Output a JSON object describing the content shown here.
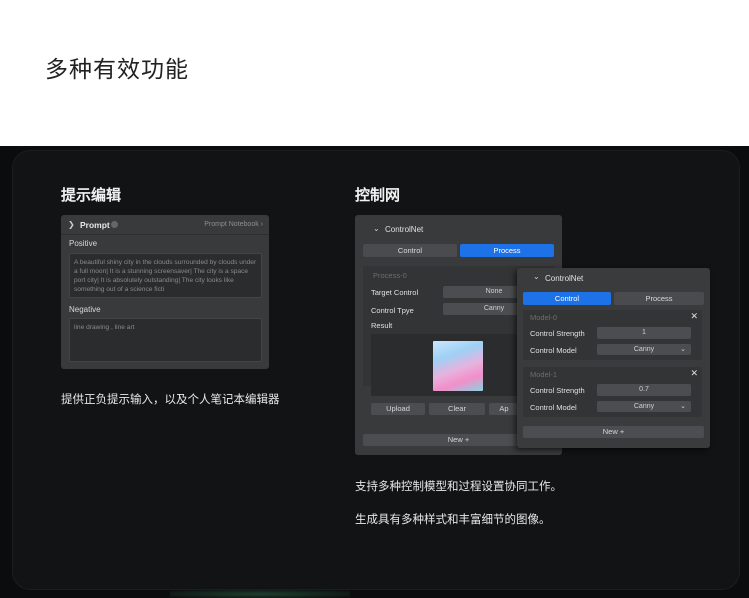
{
  "page_title": "多种有效功能",
  "left_section": {
    "title": "提示编辑",
    "description": "提供正负提示输入，以及个人笔记本编辑器",
    "panel": {
      "header_title": "Prompt",
      "notebook_label": "Prompt Notebook",
      "positive_label": "Positive",
      "positive_text": "A beautiful shiny city in the clouds surrounded by clouds under a full moon| It is a stunning screensaver| The city is a space port city| It is absolutely outstanding| The city looks like something out of a science ficti",
      "negative_label": "Negative",
      "negative_text": "line drawing , line art"
    }
  },
  "right_section": {
    "title": "控制网",
    "description_1": "支持多种控制模型和过程设置协同工作。",
    "description_2": "生成具有多种样式和丰富细节的图像。",
    "back_panel": {
      "header_title": "ControlNet",
      "tab_control": "Control",
      "tab_process": "Process",
      "process_name": "Process-0",
      "target_control_label": "Target Control",
      "target_control_value": "None",
      "control_type_label": "Control Tpye",
      "control_type_value": "Canny",
      "result_label": "Result",
      "upload_label": "Upload",
      "clear_label": "Clear",
      "apply_label": "Ap",
      "new_label": "New +"
    },
    "front_panel": {
      "header_title": "ControlNet",
      "tab_control": "Control",
      "tab_process": "Process",
      "models": [
        {
          "name": "Model-0",
          "strength_label": "Control Strength",
          "strength_value": "1",
          "model_label": "Control Model",
          "model_value": "Canny"
        },
        {
          "name": "Model-1",
          "strength_label": "Control Strength",
          "strength_value": "0.7",
          "model_label": "Control Model",
          "model_value": "Canny"
        }
      ],
      "new_label": "New +"
    }
  },
  "colors": {
    "accent": "#1e72e8",
    "background": "#0b0c0d",
    "panel": "#393a3c"
  }
}
